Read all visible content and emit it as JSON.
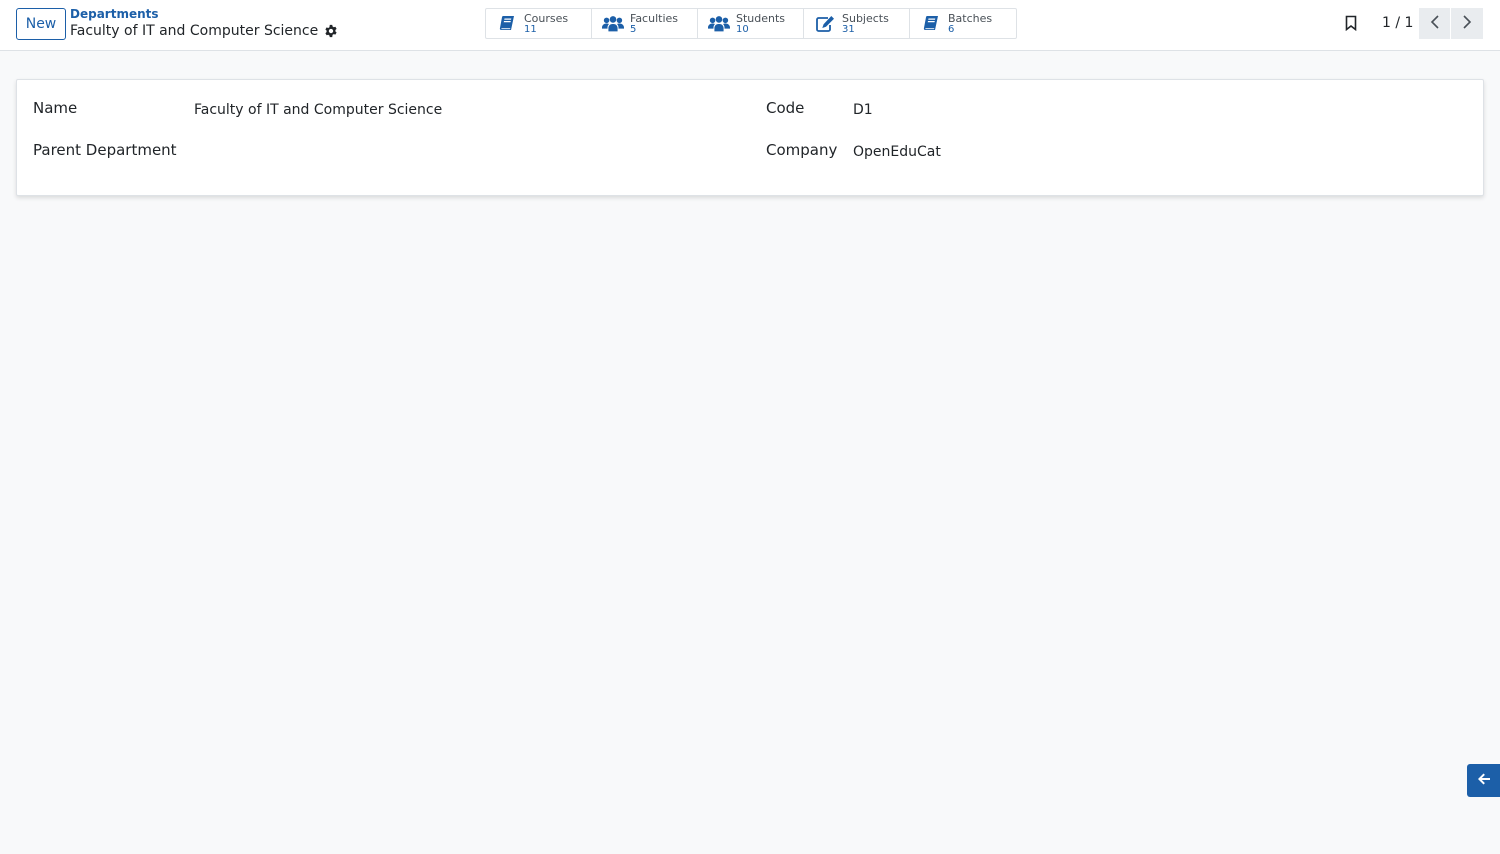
{
  "control_panel": {
    "new_label": "New",
    "breadcrumb": "Departments",
    "record_title": "Faculty of IT and Computer Science"
  },
  "smart_buttons": [
    {
      "label": "Courses",
      "count": "11",
      "icon": "book-icon"
    },
    {
      "label": "Faculties",
      "count": "5",
      "icon": "users-icon"
    },
    {
      "label": "Students",
      "count": "10",
      "icon": "users-icon"
    },
    {
      "label": "Subjects",
      "count": "31",
      "icon": "edit-icon"
    },
    {
      "label": "Batches",
      "count": "6",
      "icon": "book-icon"
    }
  ],
  "pager": {
    "value": "1 / 1"
  },
  "form": {
    "name_label": "Name",
    "name_value": "Faculty of IT and Computer Science",
    "parent_label": "Parent Department",
    "parent_value": "",
    "code_label": "Code",
    "code_value": "D1",
    "company_label": "Company",
    "company_value": "OpenEduCat"
  },
  "colors": {
    "accent": "#1c5fa8",
    "background": "#f8f9fa"
  }
}
